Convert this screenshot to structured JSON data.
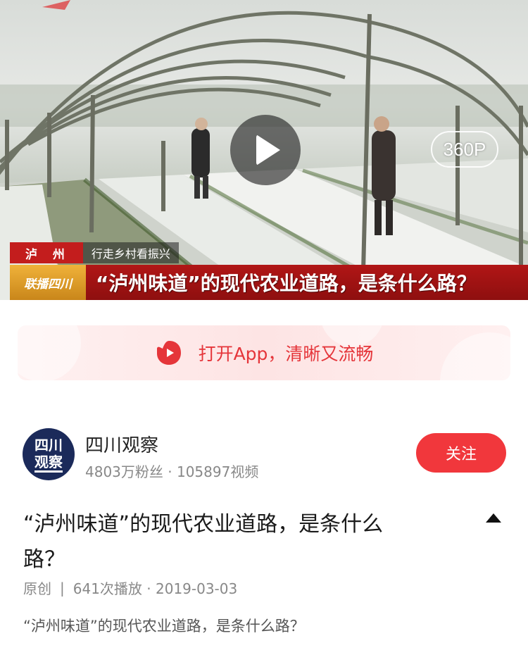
{
  "video": {
    "quality_label": "360P",
    "banner_location": "泸 州",
    "banner_subtitle": "行走乡村看振兴",
    "banner_brand": "联播四川",
    "banner_title": "“泸州味道”的现代农业道路，是条什么路？"
  },
  "app_banner": {
    "label": "打开App，清晰又流畅",
    "accent_color": "#e5353a"
  },
  "channel": {
    "avatar_line1": "四川",
    "avatar_line2": "观察",
    "name": "四川观察",
    "stats": "4803万粉丝 · 105897视频",
    "follow_label": "关注",
    "follow_color": "#f1373c"
  },
  "details": {
    "title": "“泸州味道”的现代农业道路，是条什么路？",
    "original_label": "原创",
    "views_date": "641次播放 · 2019-03-03",
    "description": "“泸州味道”的现代农业道路，是条什么路？"
  }
}
